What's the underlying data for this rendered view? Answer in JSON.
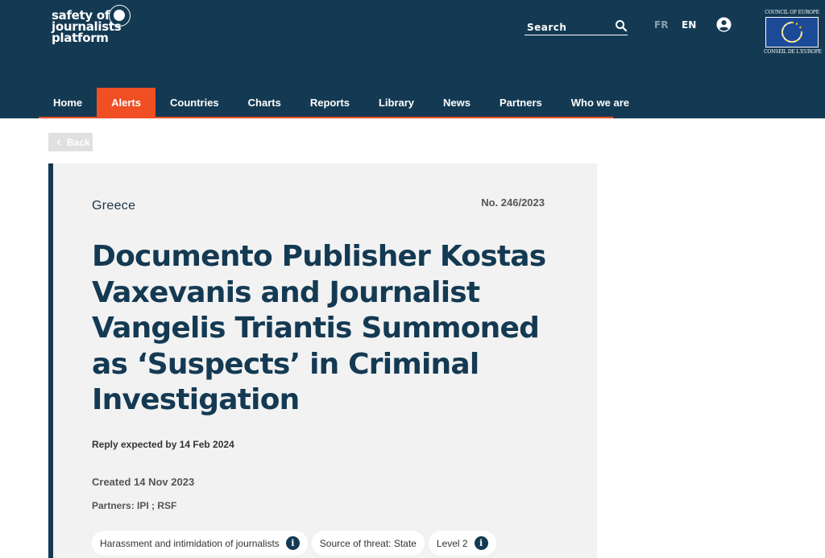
{
  "header": {
    "logo_lines": [
      "safety of",
      "journalists",
      "platform"
    ],
    "search_label": "Search",
    "lang_fr": "FR",
    "lang_en": "EN",
    "coe_top": "COUNCIL OF EUROPE",
    "coe_bottom": "CONSEIL DE L'EUROPE"
  },
  "nav": {
    "items": [
      {
        "label": "Home",
        "active": false
      },
      {
        "label": "Alerts",
        "active": true
      },
      {
        "label": "Countries",
        "active": false
      },
      {
        "label": "Charts",
        "active": false
      },
      {
        "label": "Reports",
        "active": false
      },
      {
        "label": "Library",
        "active": false
      },
      {
        "label": "News",
        "active": false
      },
      {
        "label": "Partners",
        "active": false
      },
      {
        "label": "Who we are",
        "active": false
      }
    ]
  },
  "back_label": "Back",
  "alert": {
    "country": "Greece",
    "number": "No. 246/2023",
    "title": "Documento Publisher Kostas Vaxevanis and Journalist Vangelis Triantis Summoned as ‘Suspects’ in Criminal Investigation",
    "reply": "Reply expected by 14 Feb 2024",
    "created": "Created 14 Nov 2023",
    "partners": "Partners: IPI ; RSF",
    "tags": [
      {
        "label": "Harassment and intimidation of journalists",
        "info": true
      },
      {
        "label": "Source of threat: State",
        "info": false
      },
      {
        "label": "Level 2",
        "info": true
      }
    ]
  },
  "colors": {
    "header_bg": "#143a53",
    "accent": "#f04e23",
    "card_bg": "#f2f2f2"
  },
  "icons": [
    "search-icon",
    "user-icon",
    "info-icon",
    "chevron-left-icon"
  ]
}
